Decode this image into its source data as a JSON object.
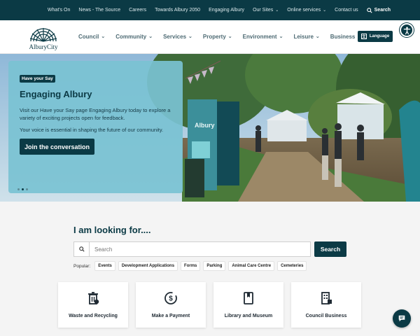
{
  "topbar": {
    "links": [
      {
        "label": "What's On",
        "dropdown": false
      },
      {
        "label": "News - The Source",
        "dropdown": false
      },
      {
        "label": "Careers",
        "dropdown": false
      },
      {
        "label": "Towards Albury 2050",
        "dropdown": false
      },
      {
        "label": "Engaging Albury",
        "dropdown": false
      },
      {
        "label": "Our Sites",
        "dropdown": true
      },
      {
        "label": "Online services",
        "dropdown": true
      },
      {
        "label": "Contact us",
        "dropdown": false
      }
    ],
    "search_label": "Search"
  },
  "logo": {
    "text": "AlburyCity"
  },
  "nav": {
    "items": [
      {
        "label": "Council"
      },
      {
        "label": "Community"
      },
      {
        "label": "Services"
      },
      {
        "label": "Property"
      },
      {
        "label": "Environment"
      },
      {
        "label": "Leisure"
      },
      {
        "label": "Business"
      }
    ],
    "language_label": "Language"
  },
  "hero": {
    "tag": "Have your Say",
    "title": "Engaging Albury",
    "paragraph1": "Visit our Have your Say page Engaging Albury today to explore a variety of exciting projects open for feedback.",
    "paragraph2": "Your voice is essential in shaping the future of our community.",
    "cta_label": "Join the conversation",
    "banner_text": "Albury",
    "slide_count": 3,
    "active_slide": 2
  },
  "search": {
    "heading": "I am looking for....",
    "placeholder": "Search",
    "button_label": "Search",
    "popular_label": "Popular:",
    "popular": [
      "Events",
      "Development Applications",
      "Forms",
      "Parking",
      "Animal Care Centre",
      "Cemeteries"
    ]
  },
  "quick_links": [
    {
      "label": "Waste and Recycling",
      "icon": "bin-icon"
    },
    {
      "label": "Make a Payment",
      "icon": "payment-icon"
    },
    {
      "label": "Library and Museum",
      "icon": "book-icon"
    },
    {
      "label": "Council Business",
      "icon": "building-icon"
    }
  ],
  "colors": {
    "brand": "#0b3a45",
    "hero_card": "#7ac2d2"
  }
}
